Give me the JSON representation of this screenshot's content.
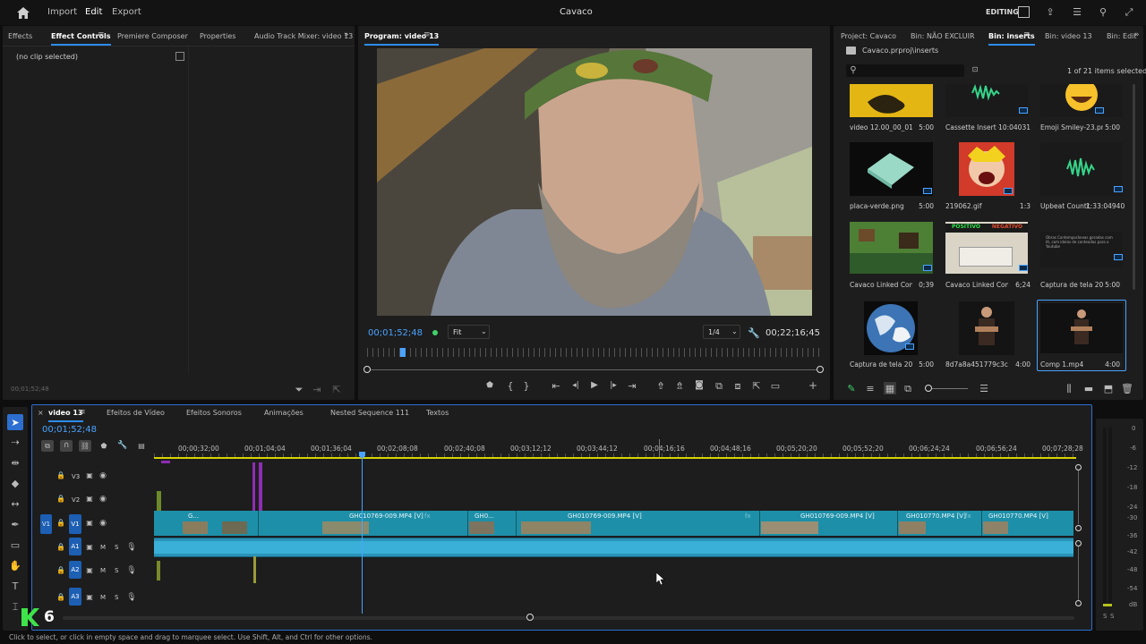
{
  "app": {
    "title": "Cavaco",
    "menu": [
      "Import",
      "Edit",
      "Export"
    ],
    "active_menu": "Edit",
    "workspace": "EDITING"
  },
  "left_panel": {
    "tabs": [
      "Effects",
      "Effect Controls",
      "Premiere Composer",
      "Properties",
      "Audio Track Mixer: video 13"
    ],
    "active_tab": "Effect Controls",
    "no_clip": "(no clip selected)",
    "timecode": "00;01;52;48"
  },
  "program": {
    "tab": "Program: video 13",
    "timecode": "00;01;52;48",
    "fit": "Fit",
    "quality": "1/4",
    "duration": "00;22;16;45"
  },
  "project": {
    "tabs": [
      "Project: Cavaco",
      "Bin: NÃO EXCLUIR",
      "Bin: inserts",
      "Bin: video 13",
      "Bin: Edit"
    ],
    "active_tab": "Bin: inserts",
    "path": "Cavaco.prproj\\inserts",
    "selection": "1 of 21 items selected",
    "items": [
      {
        "name": "video 12.00_00_01_...",
        "dur": "5:00"
      },
      {
        "name": "Cassette Insert - ...",
        "dur": "10:04031"
      },
      {
        "name": "Emoji Smiley-23.png",
        "dur": "5:00"
      },
      {
        "name": "placa-verde.png",
        "dur": "5:00"
      },
      {
        "name": "219062.gif",
        "dur": "1:3"
      },
      {
        "name": "Upbeat Countr...",
        "dur": "1:33:04940"
      },
      {
        "name": "Cavaco Linked Comp...",
        "dur": "0;39"
      },
      {
        "name": "Cavaco Linked Comp...",
        "dur": "6;24"
      },
      {
        "name": "Captura de tela 2026-...",
        "dur": "5:00"
      },
      {
        "name": "Captura de tela 2026...",
        "dur": "5:00"
      },
      {
        "name": "8d7a8a451779c3c44...",
        "dur": "4:00"
      },
      {
        "name": "Comp 1.mp4",
        "dur": "4:00"
      }
    ],
    "thumb_text": {
      "positivo": "POSITIVO",
      "negativo": "NEGATIVO",
      "screenshot_line": "Obras Contemporâneas geradas com IA, com ideias de conteúdos para o Youtube"
    }
  },
  "timeline": {
    "tabs": [
      "video 13",
      "Efeitos de Vídeo",
      "Efeitos Sonoros",
      "Animações",
      "Nested Sequence 111",
      "Textos"
    ],
    "active_tab": "video 13",
    "timecode": "00;01;52;48",
    "ruler": [
      "00;00;32;00",
      "00;01;04;04",
      "00;01;36;04",
      "00;02;08;08",
      "00;02;40;08",
      "00;03;12;12",
      "00;03;44;12",
      "00;04;16;16",
      "00;04;48;16",
      "00;05;20;20",
      "00;05;52;20",
      "00;06;24;24",
      "00;06;56;24",
      "00;07;28;28"
    ],
    "video_tracks": [
      "V3",
      "V2",
      "V1"
    ],
    "audio_tracks": [
      "A1",
      "A2",
      "A3"
    ],
    "v1_source": "V1",
    "a1_source": "A1",
    "mute": "M",
    "solo": "S",
    "clips": [
      "G...",
      "GH010769-009.MP4 [V]",
      "GH0...",
      "GH010769-009.MP4 [V]",
      "GH010769-009.MP4 [V]",
      "GH010770.MP4 [V]",
      "GH010770.MP4 [V]"
    ],
    "fx": "fx"
  },
  "meter": {
    "labels": [
      "0",
      "-6",
      "-12",
      "-18",
      "-24",
      "-30",
      "-36",
      "-42",
      "-48",
      "-54",
      "dB"
    ],
    "solo": [
      "S",
      "S"
    ]
  },
  "logo": {
    "number": "6"
  },
  "status": "Click to select, or click in empty space and drag to marquee select. Use Shift, Alt, and Ctrl for other options.",
  "icons": {
    "home": "home-icon",
    "selection": "selection-tool-icon",
    "ripple": "ripple-edit-icon",
    "razor": "razor-tool-icon",
    "pen": "pen-tool-icon",
    "hand": "hand-tool-icon",
    "type": "type-tool-icon"
  },
  "colors": {
    "accent": "#2d8ceb",
    "clip_video": "#1e8fa8",
    "clip_audio": "#3ab0d8",
    "playhead": "#4aa3ff",
    "work_area": "#d7d400"
  }
}
